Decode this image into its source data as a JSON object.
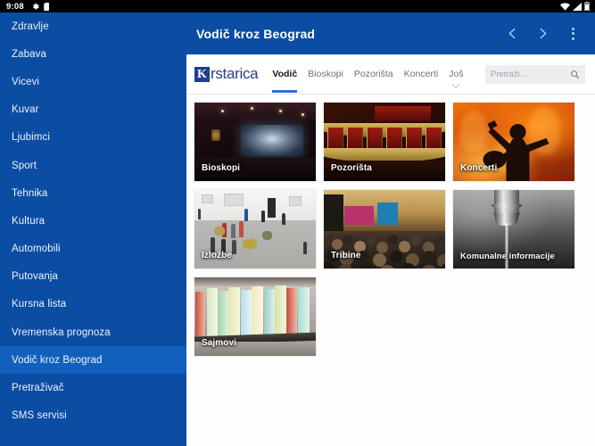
{
  "statusbar": {
    "time": "9:08",
    "left_icons": [
      "gear-icon",
      "sd-card-icon"
    ],
    "right_icons": [
      "wifi-icon",
      "signal-icon",
      "battery-icon"
    ]
  },
  "sidebar": {
    "background": "#0a4da2",
    "selected_background": "#1160bd",
    "items": [
      {
        "label": "Zdravlje",
        "selected": false
      },
      {
        "label": "Zabava",
        "selected": false
      },
      {
        "label": "Vicevi",
        "selected": false
      },
      {
        "label": "Kuvar",
        "selected": false
      },
      {
        "label": "Ljubimci",
        "selected": false
      },
      {
        "label": "Sport",
        "selected": false
      },
      {
        "label": "Tehnika",
        "selected": false
      },
      {
        "label": "Kultura",
        "selected": false
      },
      {
        "label": "Automobili",
        "selected": false
      },
      {
        "label": "Putovanja",
        "selected": false
      },
      {
        "label": "Kursna lista",
        "selected": false
      },
      {
        "label": "Vremenska prognoza",
        "selected": false
      },
      {
        "label": "Vodič kroz Beograd",
        "selected": true
      },
      {
        "label": "Pretraživač",
        "selected": false
      },
      {
        "label": "SMS servisi",
        "selected": false
      }
    ]
  },
  "appbar": {
    "title": "Vodič kroz Beograd",
    "back_label": "‹",
    "forward_label": "›",
    "overflow_label": "⋮"
  },
  "webview": {
    "logo": {
      "mark": "K",
      "text": "rstarica"
    },
    "tabs": [
      {
        "label": "Vodič",
        "active": true
      },
      {
        "label": "Bioskopi",
        "active": false
      },
      {
        "label": "Pozorišta",
        "active": false
      },
      {
        "label": "Koncerti",
        "active": false
      },
      {
        "label": "Još",
        "active": false,
        "has_caret": true
      }
    ],
    "search": {
      "placeholder": "Pretraži...",
      "value": "",
      "icon": "search-icon"
    },
    "cards": [
      {
        "label": "Bioskopi",
        "art": "cinema"
      },
      {
        "label": "Pozorišta",
        "art": "theatre"
      },
      {
        "label": "Koncerti",
        "art": "fire"
      },
      {
        "label": "Izložbe",
        "art": "gallery"
      },
      {
        "label": "Tribine",
        "art": "crowd"
      },
      {
        "label": "Komunalne informacije",
        "art": "faucet"
      },
      {
        "label": "Sajmovi",
        "art": "books"
      }
    ]
  },
  "colors": {
    "brand_blue": "#0a4da2",
    "tab_accent": "#2f6fd0",
    "logo_blue": "#26418f",
    "page_bg": "#ffffff"
  }
}
